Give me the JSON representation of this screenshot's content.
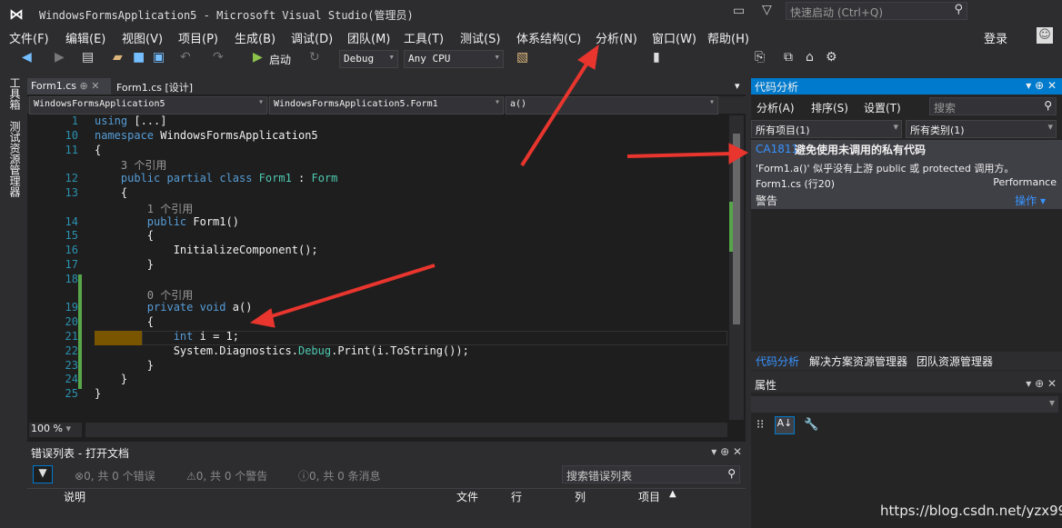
{
  "title": {
    "text": "WindowsFormsApplication5 - Microsoft Visual Studio(管理员)",
    "quick_launch": "快速启动 (Ctrl+Q)"
  },
  "menu": [
    "文件(F)",
    "编辑(E)",
    "视图(V)",
    "项目(P)",
    "生成(B)",
    "调试(D)",
    "团队(M)",
    "工具(T)",
    "测试(S)",
    "体系结构(C)",
    "分析(N)",
    "窗口(W)",
    "帮助(H)"
  ],
  "signin": "登录",
  "toolbar": {
    "start": "启动",
    "config": "Debug",
    "platform": "Any CPU"
  },
  "left_tabs": {
    "toolbox": "工具箱",
    "test_explorer": "测试资源管理器"
  },
  "editor": {
    "tab1": "Form1.cs",
    "tab2": "Form1.cs [设计]",
    "nav1": "WindowsFormsApplication5",
    "nav2": "WindowsFormsApplication5.Form1",
    "nav3": "a()",
    "zoom": "100 %"
  },
  "code": [
    {
      "n": "1",
      "t": "using [...]"
    },
    {
      "n": "10",
      "t": "namespace WindowsFormsApplication5"
    },
    {
      "n": "11",
      "t": "{"
    },
    {
      "n": "",
      "t": "    3 个引用"
    },
    {
      "n": "12",
      "t": "    public partial class Form1 : Form"
    },
    {
      "n": "13",
      "t": "    {"
    },
    {
      "n": "",
      "t": "        1 个引用"
    },
    {
      "n": "14",
      "t": "        public Form1()"
    },
    {
      "n": "15",
      "t": "        {"
    },
    {
      "n": "16",
      "t": "            InitializeComponent();"
    },
    {
      "n": "17",
      "t": "        }"
    },
    {
      "n": "18",
      "t": ""
    },
    {
      "n": "",
      "t": "        0 个引用"
    },
    {
      "n": "19",
      "t": "        private void a()"
    },
    {
      "n": "20",
      "t": "        {"
    },
    {
      "n": "21",
      "t": "            int i = 1;"
    },
    {
      "n": "22",
      "t": "            System.Diagnostics.Debug.Print(i.ToString());"
    },
    {
      "n": "23",
      "t": "        }"
    },
    {
      "n": "24",
      "t": "    }"
    },
    {
      "n": "25",
      "t": "}"
    }
  ],
  "errors": {
    "title": "错误列表 - 打开文档",
    "errors": "0, 共 0 个错误",
    "warnings": "0, 共 0 个警告",
    "messages": "0, 共 0 条消息",
    "search": "搜索错误列表",
    "cols": [
      "说明",
      "文件",
      "行",
      "列",
      "项目"
    ]
  },
  "analysis": {
    "title": "代码分析",
    "menu": [
      "分析(A)",
      "排序(S)",
      "设置(T)"
    ],
    "search": "搜索",
    "filter1": "所有项目(1)",
    "filter2": "所有类别(1)",
    "id": "CA1811",
    "name": "避免使用未调用的私有代码",
    "desc": "'Form1.a()' 似乎没有上游 public 或 protected 调用方。",
    "location": "Form1.cs (行20)",
    "category": "Performance",
    "severity": "警告",
    "action": "操作",
    "tabs": [
      "代码分析",
      "解决方案资源管理器",
      "团队资源管理器"
    ]
  },
  "properties": {
    "title": "属性"
  },
  "watermark": "https://blog.csdn.net/yzx99",
  "colors": {
    "bg": "#2d2d30",
    "editor": "#1e1e1e",
    "accent": "#007acc",
    "arrow": "#e8352e"
  }
}
